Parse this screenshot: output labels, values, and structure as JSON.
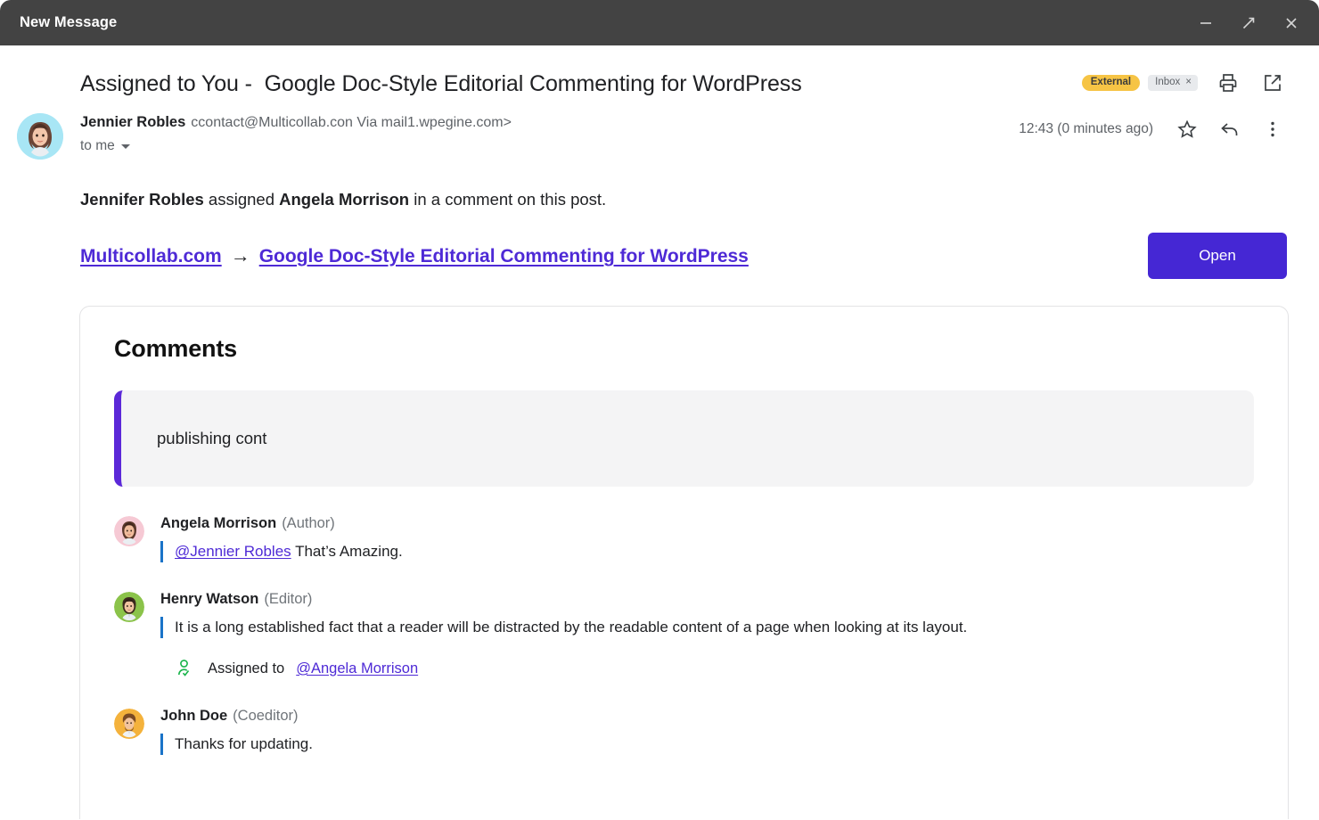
{
  "window": {
    "title": "New Message",
    "controls": [
      {
        "name": "minimize",
        "icon": "minimize-icon"
      },
      {
        "name": "popout",
        "icon": "popout-arrow-icon"
      },
      {
        "name": "close",
        "icon": "close-icon"
      }
    ]
  },
  "email": {
    "subject": "Assigned to You -  Google Doc-Style Editorial Commenting for WordPress",
    "badges": {
      "external": "External",
      "inbox": "Inbox",
      "inbox_close": "×"
    },
    "tools": {
      "print": "print-icon",
      "open_in_new": "open-in-new-icon",
      "star": "star-icon",
      "reply": "reply-icon",
      "more": "more-vertical-icon"
    },
    "sender": {
      "name": "Jennier Robles",
      "address": "ccontact@Multicollab.con Via mail1.wpegine.com>",
      "recipient": "to me"
    },
    "timestamp": "12:43 (0 minutes ago)",
    "notice": {
      "actor": "Jennifer Robles",
      "verb": " assigned ",
      "target": "Angela Morrison",
      "tail": " in a comment on this post."
    },
    "breadcrumb": {
      "site": "Multicollab.com",
      "arrow": "→",
      "post": "Google Doc-Style Editorial Commenting for WordPress"
    },
    "open_button": "Open"
  },
  "comments_card": {
    "title": "Comments",
    "quote": "publishing cont",
    "items": [
      {
        "name": "Angela Morrison",
        "role": "(Author)",
        "mention": "@Jennier Robles",
        "text": " That’s Amazing.",
        "avatar_color": "#f6c9d4"
      },
      {
        "name": "Henry Watson",
        "role": "(Editor)",
        "mention": "",
        "text": "It is a long established fact that a reader will be distracted by the readable content of a page when looking at its layout.",
        "avatar_color": "#8bc34a",
        "assigned_label": "Assigned to",
        "assigned_to": "@Angela Morrison"
      },
      {
        "name": "John Doe",
        "role": "(Coeditor)",
        "mention": "",
        "text": "Thanks for updating.",
        "avatar_color": "#f4b23c"
      }
    ]
  },
  "colors": {
    "titlebar": "#434343",
    "accent_purple": "#4527d4",
    "link_purple": "#4e2ad6",
    "badge_yellow": "#f6c445",
    "quote_bar": "#5b28d8",
    "comment_bar": "#1a73c8",
    "assigned_green": "#18b44a"
  }
}
